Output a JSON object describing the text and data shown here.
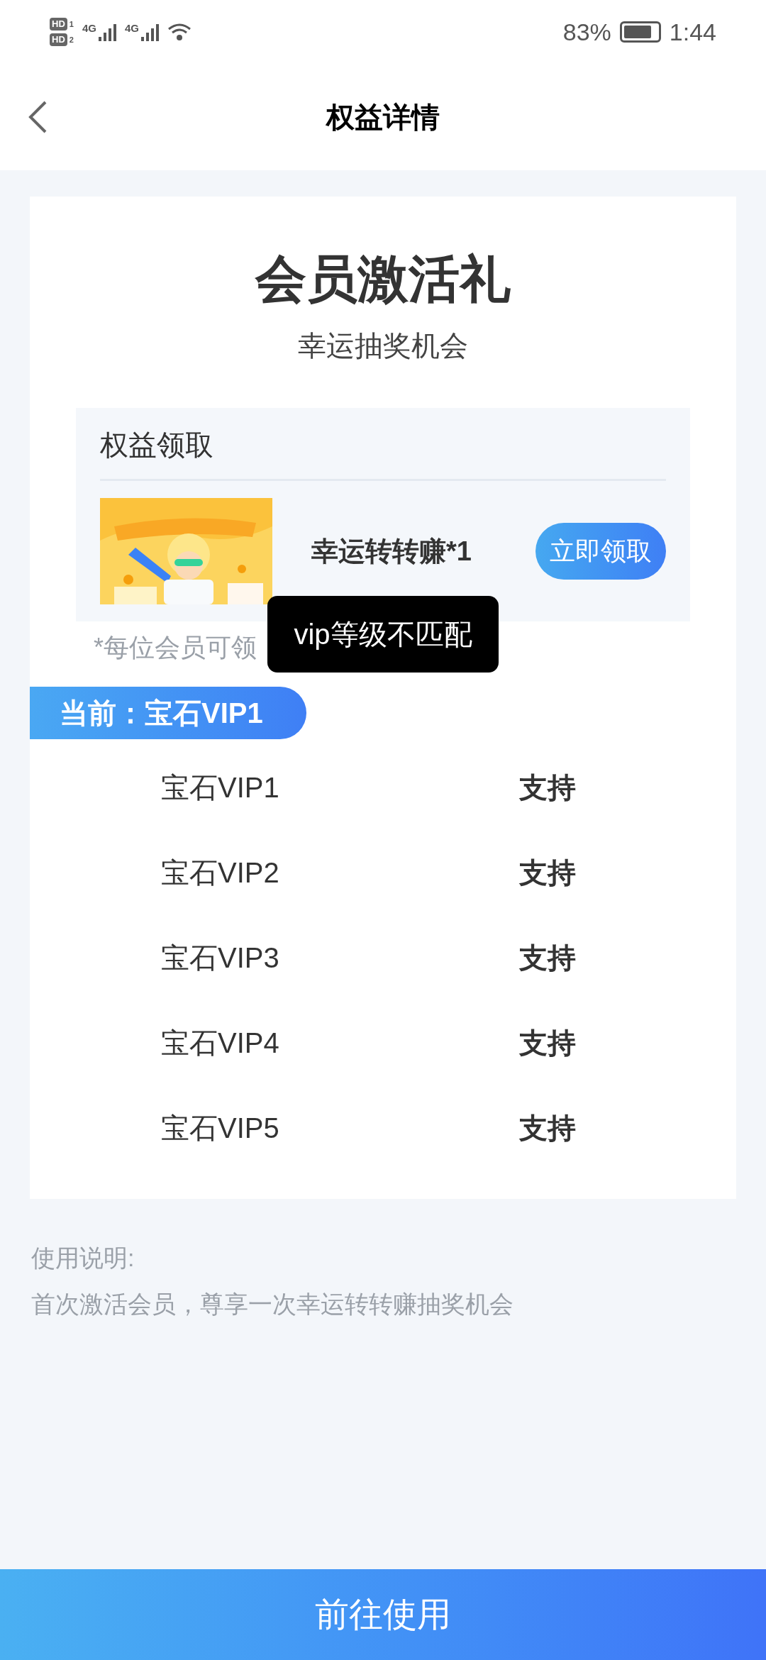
{
  "status_bar": {
    "sims": [
      {
        "label": "HD",
        "index": "1"
      },
      {
        "label": "HD",
        "index": "2"
      }
    ],
    "networks": [
      {
        "label": "4G"
      },
      {
        "label": "4G"
      }
    ],
    "battery_text": "83%",
    "time": "1:44"
  },
  "header": {
    "title": "权益详情"
  },
  "card": {
    "title": "会员激活礼",
    "subtitle": "幸运抽奖机会",
    "rewards": {
      "heading": "权益领取",
      "items": [
        {
          "name": "幸运转转赚*1",
          "button": "立即领取"
        }
      ]
    },
    "note": "*每位会员可领",
    "current_level": "当前：宝石VIP1",
    "levels": [
      {
        "name": "宝石VIP1",
        "support": "支持"
      },
      {
        "name": "宝石VIP2",
        "support": "支持"
      },
      {
        "name": "宝石VIP3",
        "support": "支持"
      },
      {
        "name": "宝石VIP4",
        "support": "支持"
      },
      {
        "name": "宝石VIP5",
        "support": "支持"
      }
    ]
  },
  "usage": {
    "heading": "使用说明:",
    "text": "首次激活会员，尊享一次幸运转转赚抽奖机会"
  },
  "toast": "vip等级不匹配",
  "bottom_button": "前往使用"
}
